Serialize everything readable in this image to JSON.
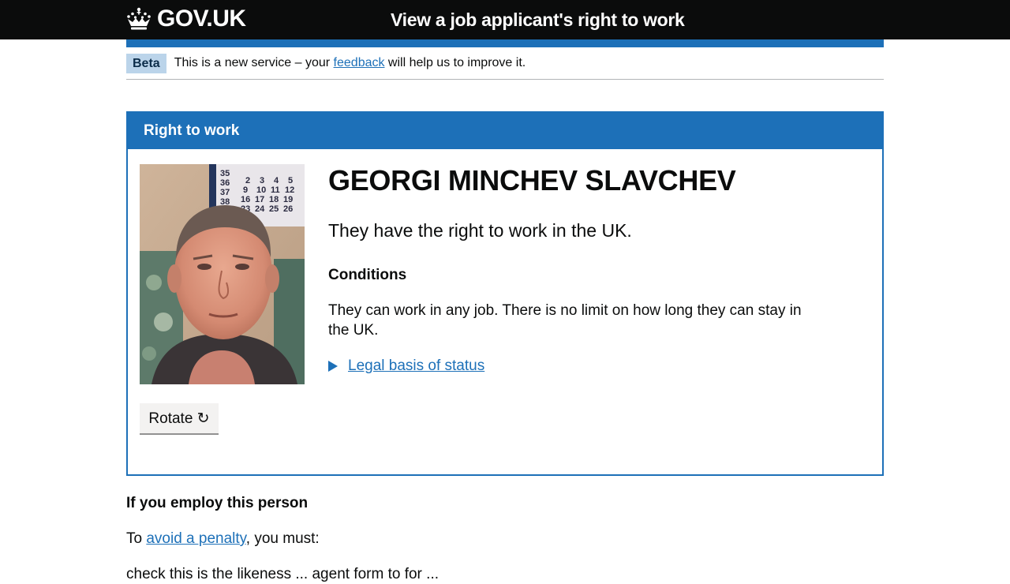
{
  "header": {
    "logo_text": "GOV.UK",
    "logo_icon": "crown-icon",
    "service_name": "View a job applicant's right to work"
  },
  "phase": {
    "tag": "Beta",
    "text_before": "This is a new service – your ",
    "link": "feedback",
    "text_after": " will help us to improve it."
  },
  "panel": {
    "title": "Right to work",
    "person_name": "GEORGI MINCHEV SLAVCHEV",
    "status": "They have the right to work in the UK.",
    "conditions_heading": "Conditions",
    "conditions_text": "They can work in any job. There is no limit on how long they can stay in the UK.",
    "legal_basis_link": "Legal basis of status",
    "rotate_button": "Rotate ↻",
    "photo_calendar_numbers": [
      "35",
      "36",
      "37",
      "38",
      "2",
      "3",
      "4",
      "5",
      "9",
      "10",
      "11",
      "12",
      "16",
      "17",
      "18",
      "19",
      "23",
      "24",
      "25",
      "26"
    ]
  },
  "employ": {
    "heading": "If you employ this person",
    "text_before": "To ",
    "link": "avoid a penalty",
    "text_after": ", you must:",
    "next_line": "check this is the likeness ... agent form to for ..."
  },
  "colors": {
    "header_bg": "#0b0c0c",
    "brand_blue": "#1d70b8",
    "phase_tag_bg": "#bbd4ea",
    "button_bg": "#f3f2f1"
  }
}
